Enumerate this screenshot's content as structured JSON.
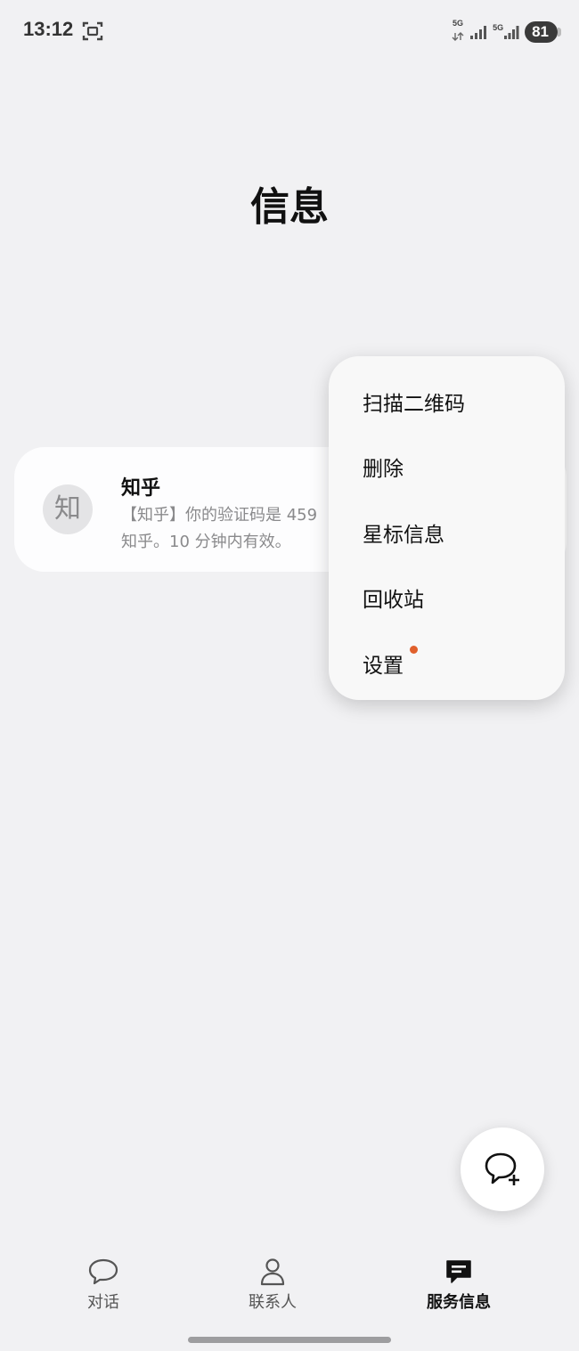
{
  "status_bar": {
    "time": "13:12",
    "network_1": "5G",
    "network_2": "5G",
    "battery": "81"
  },
  "page": {
    "title": "信息"
  },
  "messages": [
    {
      "avatar_text": "知",
      "sender": "知乎",
      "preview": "【知乎】你的验证码是 459\n知乎。10 分钟内有效。"
    }
  ],
  "menu": {
    "items": [
      {
        "label": "扫描二维码"
      },
      {
        "label": "删除"
      },
      {
        "label": "星标信息"
      },
      {
        "label": "回收站"
      },
      {
        "label": "设置",
        "badge_color": "#e0602c"
      }
    ]
  },
  "fab": {
    "icon": "new-message-icon"
  },
  "bottom_nav": {
    "items": [
      {
        "label": "对话",
        "icon": "chat-bubble-icon"
      },
      {
        "label": "联系人",
        "icon": "person-icon"
      },
      {
        "label": "服务信息",
        "icon": "service-message-icon",
        "active": true
      }
    ]
  }
}
